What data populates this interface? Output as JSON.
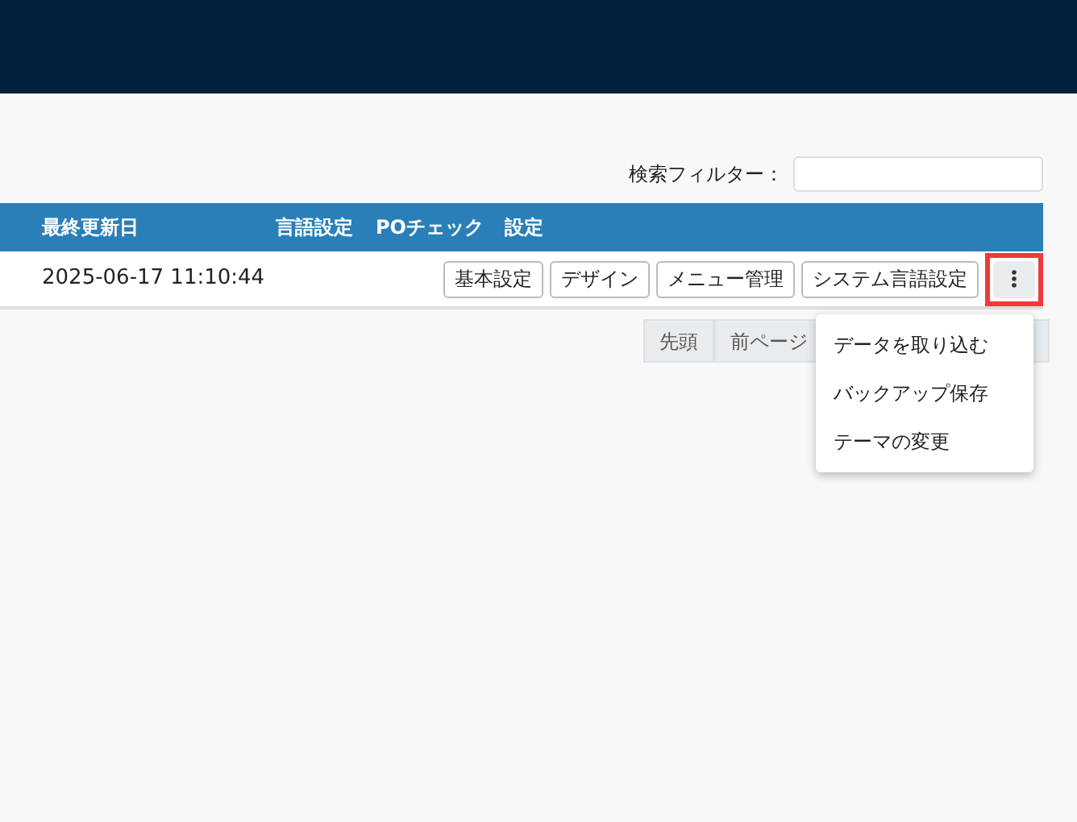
{
  "filter": {
    "label": "検索フィルター："
  },
  "table": {
    "columns": [
      "最終更新日",
      "言語設定",
      "POチェック",
      "設定"
    ],
    "rows": [
      {
        "updated": "2025-06-17 11:10:44",
        "actions": [
          "基本設定",
          "デザイン",
          "メニュー管理",
          "システム言語設定"
        ],
        "menu_highlighted": true
      }
    ]
  },
  "pagination": [
    "先頭",
    "前ページ"
  ],
  "menu": {
    "items": [
      "データを取り込む",
      "バックアップ保存",
      "テーマの変更"
    ]
  }
}
